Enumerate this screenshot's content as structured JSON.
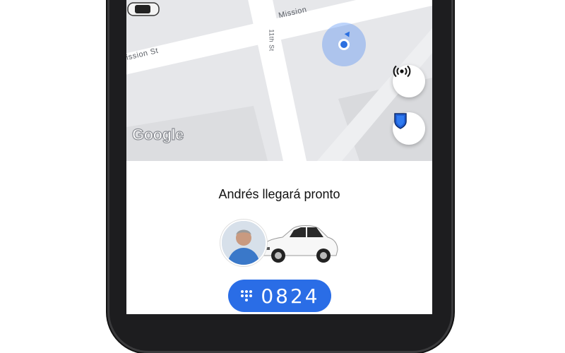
{
  "map": {
    "street_labels": [
      "Mission St",
      "Mission",
      "11th St"
    ],
    "attribution": "Google"
  },
  "buttons": {
    "radar_icon": "broadcast-icon",
    "shield_icon": "shield-icon"
  },
  "trip": {
    "status_title": "Andrés llegará pronto",
    "pin_code": "0824",
    "pin_icon": "keypad-icon"
  },
  "colors": {
    "accent": "#2a6de6",
    "location_dot": "#2b6fe0",
    "map_bg": "#e6e7ea"
  }
}
